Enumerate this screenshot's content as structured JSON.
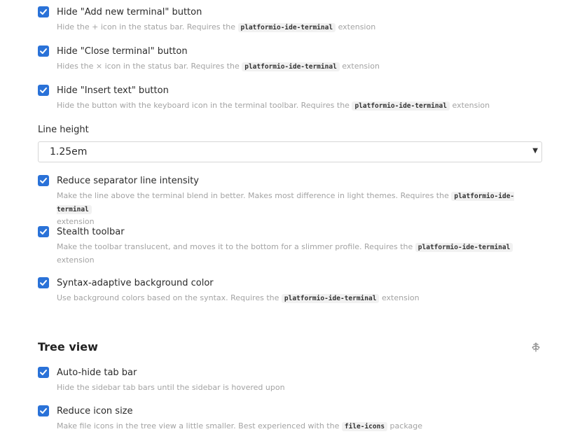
{
  "terminal_settings": [
    {
      "title": "Hide \"Add new terminal\" button",
      "desc_before": "Hide the + icon in the status bar. Requires the",
      "code": "platformio-ide-terminal",
      "desc_after": "extension",
      "checked": true
    },
    {
      "title": "Hide \"Close terminal\" button",
      "desc_before": "Hides the × icon in the status bar. Requires the",
      "code": "platformio-ide-terminal",
      "desc_after": "extension",
      "checked": true
    },
    {
      "title": "Hide \"Insert text\" button",
      "desc_before": "Hide the button with the keyboard icon in the terminal toolbar. Requires the",
      "code": "platformio-ide-terminal",
      "desc_after": "extension",
      "checked": true
    }
  ],
  "line_height": {
    "label": "Line height",
    "value": "1.25em"
  },
  "terminal_settings_2": [
    {
      "title": "Reduce separator line intensity",
      "desc_before": "Make the line above the terminal blend in better. Makes most difference in light themes. Requires the",
      "code": "platformio-ide-terminal",
      "desc_after": "extension",
      "checked": true
    },
    {
      "title": "Stealth toolbar",
      "desc_before": "Make the toolbar translucent, and moves it to the bottom for a slimmer profile. Requires the",
      "code": "platformio-ide-terminal",
      "desc_after": "extension",
      "checked": true
    },
    {
      "title": "Syntax-adaptive background color",
      "desc_before": "Use background colors based on the syntax. Requires the",
      "code": "platformio-ide-terminal",
      "desc_after": "extension",
      "checked": true
    }
  ],
  "tree_view": {
    "section_title": "Tree view",
    "section_icon": "tree-icon",
    "settings": [
      {
        "title": "Auto-hide tab bar",
        "desc_before": "Hide the sidebar tab bars until the sidebar is hovered upon",
        "code": "",
        "desc_after": "",
        "checked": true
      },
      {
        "title": "Reduce icon size",
        "desc_before": "Make file icons in the tree view a little smaller. Best experienced with the",
        "code": "file-icons",
        "desc_after": "package",
        "checked": true
      }
    ]
  },
  "colors": {
    "checkbox": "#2a72d8",
    "description": "#a3a3a3"
  }
}
